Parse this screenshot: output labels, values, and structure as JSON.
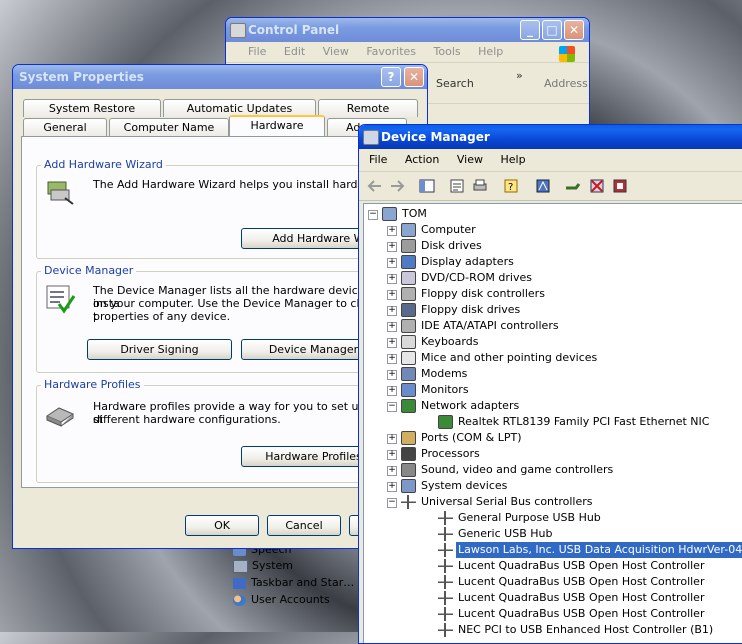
{
  "control_panel": {
    "title": "Control Panel",
    "menu": [
      "File",
      "Edit",
      "View",
      "Favorites",
      "Tools",
      "Help"
    ],
    "toolbar": {
      "search": "Search",
      "address": "Address",
      "more": "»"
    },
    "items": [
      "Speech",
      "System",
      "Taskbar and Star…",
      "User Accounts"
    ]
  },
  "system_properties": {
    "title": "System Properties",
    "title_buttons": {
      "help": "?",
      "close": "✕"
    },
    "tabs_top": [
      "System Restore",
      "Automatic Updates",
      "Remote"
    ],
    "tabs_bottom": [
      "General",
      "Computer Name",
      "Hardware",
      "Ad"
    ],
    "wizard": {
      "title": "Add Hardware Wizard",
      "text": "The Add Hardware Wizard helps you install hardware.",
      "button": "Add Hardware Wiza"
    },
    "device_manager": {
      "title": "Device Manager",
      "text1": "The Device Manager lists all the hardware devices insta",
      "text2": "on your computer. Use the Device Manager to change t",
      "text3": "properties of any device.",
      "driver_button": "Driver Signing",
      "dm_button": "Device Manager"
    },
    "profiles": {
      "title": "Hardware Profiles",
      "text1": "Hardware profiles provide a way for you to set up and st",
      "text2": "different hardware configurations.",
      "button": "Hardware Profiles"
    },
    "ok": "OK",
    "cancel": "Cancel"
  },
  "device_manager": {
    "title": "Device Manager",
    "menu": [
      "File",
      "Action",
      "View",
      "Help"
    ],
    "tree": [
      {
        "label": "TOM",
        "level": 0,
        "expander": "−",
        "icon": "computer-icon"
      },
      {
        "label": "Computer",
        "level": 1,
        "expander": "+",
        "icon": "computer-icon"
      },
      {
        "label": "Disk drives",
        "level": 1,
        "expander": "+",
        "icon": "disk-drive-icon"
      },
      {
        "label": "Display adapters",
        "level": 1,
        "expander": "+",
        "icon": "display-icon"
      },
      {
        "label": "DVD/CD-ROM drives",
        "level": 1,
        "expander": "+",
        "icon": "cdrom-icon"
      },
      {
        "label": "Floppy disk controllers",
        "level": 1,
        "expander": "+",
        "icon": "controller-icon"
      },
      {
        "label": "Floppy disk drives",
        "level": 1,
        "expander": "+",
        "icon": "floppy-icon"
      },
      {
        "label": "IDE ATA/ATAPI controllers",
        "level": 1,
        "expander": "+",
        "icon": "controller-icon"
      },
      {
        "label": "Keyboards",
        "level": 1,
        "expander": "+",
        "icon": "keyboard-icon"
      },
      {
        "label": "Mice and other pointing devices",
        "level": 1,
        "expander": "+",
        "icon": "mouse-icon"
      },
      {
        "label": "Modems",
        "level": 1,
        "expander": "+",
        "icon": "modem-icon"
      },
      {
        "label": "Monitors",
        "level": 1,
        "expander": "+",
        "icon": "monitor-icon"
      },
      {
        "label": "Network adapters",
        "level": 1,
        "expander": "−",
        "icon": "network-icon"
      },
      {
        "label": "Realtek RTL8139 Family PCI Fast Ethernet NIC",
        "level": 2,
        "expander": "",
        "icon": "network-icon"
      },
      {
        "label": "Ports (COM & LPT)",
        "level": 1,
        "expander": "+",
        "icon": "port-icon"
      },
      {
        "label": "Processors",
        "level": 1,
        "expander": "+",
        "icon": "processor-icon"
      },
      {
        "label": "Sound, video and game controllers",
        "level": 1,
        "expander": "+",
        "icon": "sound-icon"
      },
      {
        "label": "System devices",
        "level": 1,
        "expander": "+",
        "icon": "system-device-icon"
      },
      {
        "label": "Universal Serial Bus controllers",
        "level": 1,
        "expander": "−",
        "icon": "usb-icon"
      },
      {
        "label": "General Purpose USB Hub",
        "level": 2,
        "expander": "",
        "icon": "usb-icon"
      },
      {
        "label": "Generic USB Hub",
        "level": 2,
        "expander": "",
        "icon": "usb-icon"
      },
      {
        "label": "Lawson Labs, Inc. USB Data Acquisition HdwrVer-04",
        "level": 2,
        "expander": "",
        "icon": "usb-icon",
        "selected": true
      },
      {
        "label": "Lucent QuadraBus USB Open Host Controller",
        "level": 2,
        "expander": "",
        "icon": "usb-icon"
      },
      {
        "label": "Lucent QuadraBus USB Open Host Controller",
        "level": 2,
        "expander": "",
        "icon": "usb-icon"
      },
      {
        "label": "Lucent QuadraBus USB Open Host Controller",
        "level": 2,
        "expander": "",
        "icon": "usb-icon"
      },
      {
        "label": "Lucent QuadraBus USB Open Host Controller",
        "level": 2,
        "expander": "",
        "icon": "usb-icon"
      },
      {
        "label": "NEC PCI to USB Enhanced Host Controller (B1)",
        "level": 2,
        "expander": "",
        "icon": "usb-icon"
      }
    ]
  }
}
